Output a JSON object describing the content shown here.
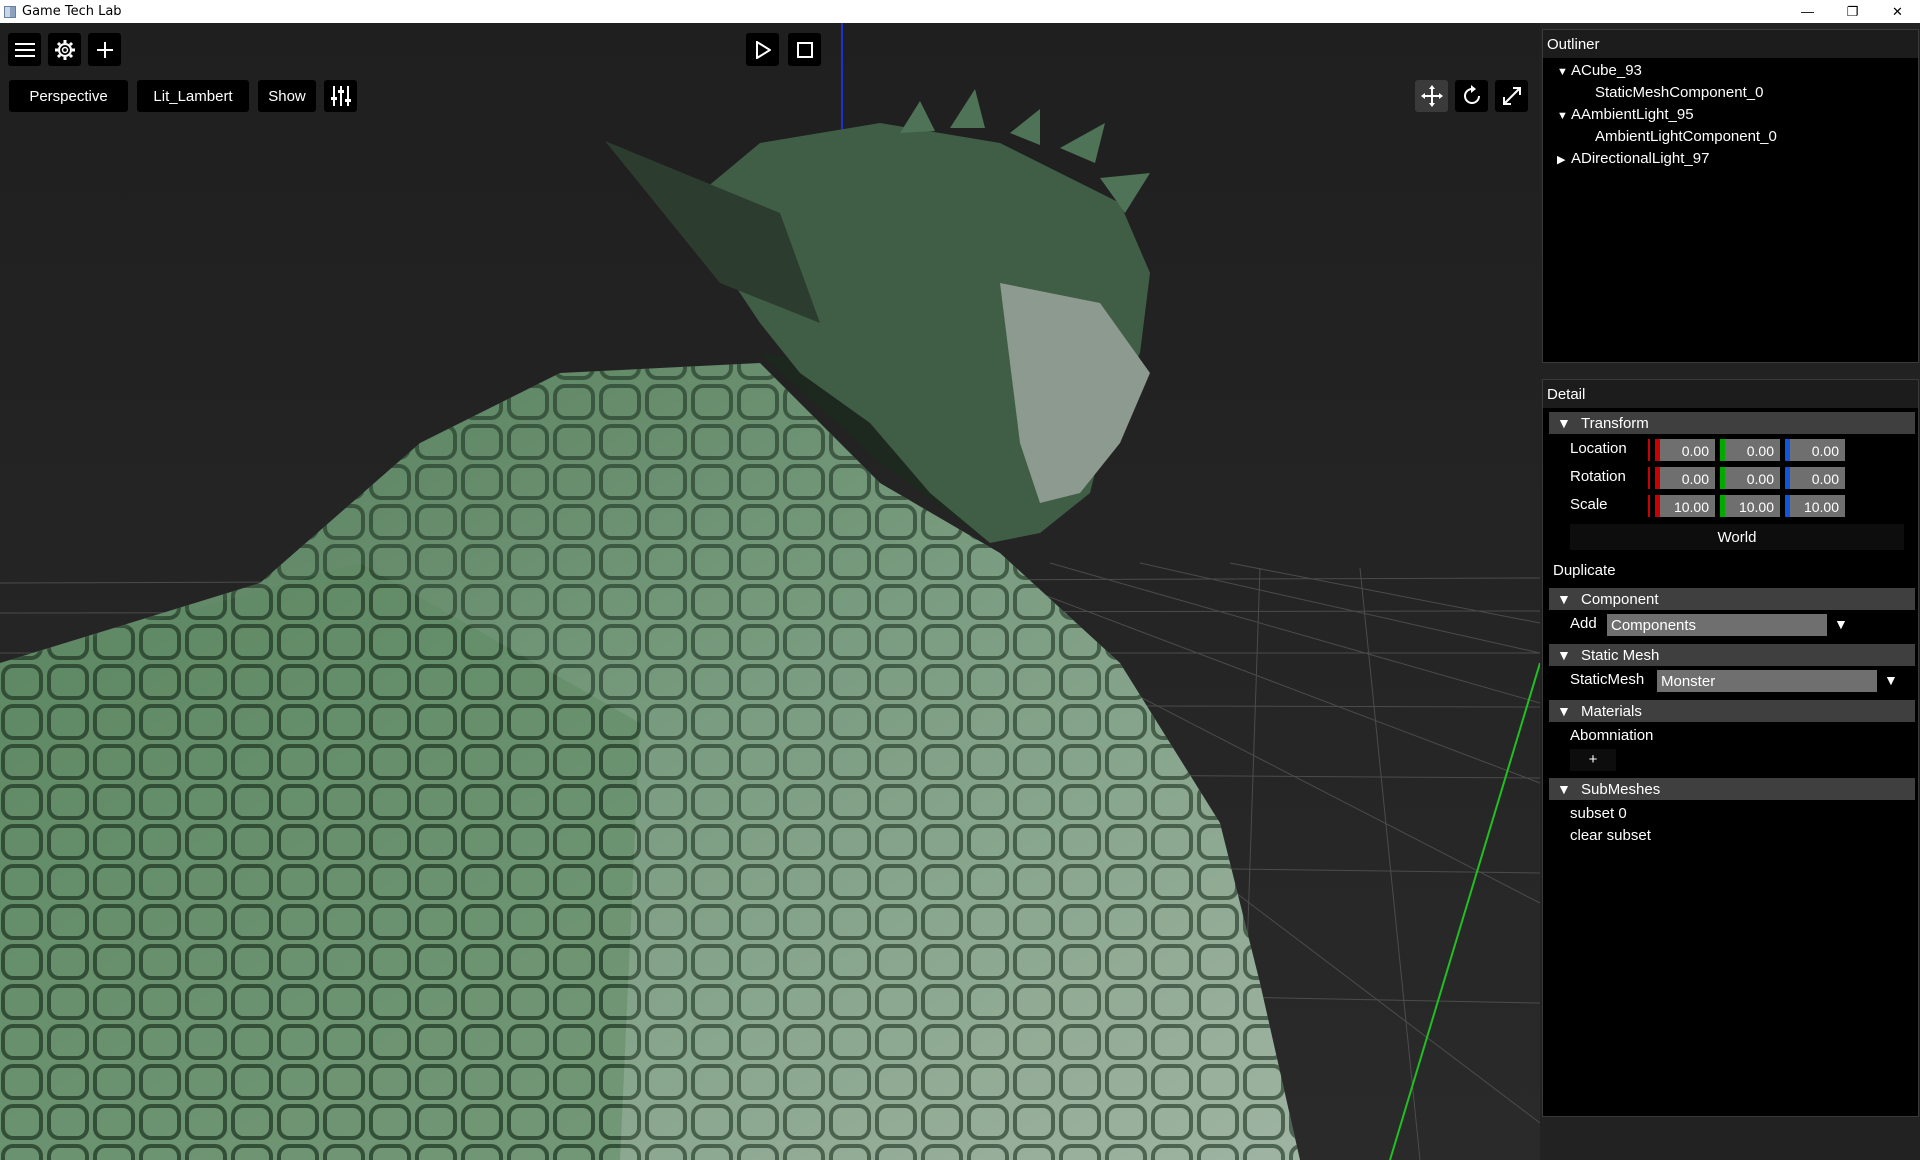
{
  "window": {
    "title": "Game Tech Lab",
    "minimize_glyph": "—",
    "restore_glyph": "❐",
    "close_glyph": "✕"
  },
  "viewport": {
    "view_mode": "Perspective",
    "view_shading": "Lit_Lambert",
    "show_label": "Show",
    "icons": [
      "menu-icon",
      "gear-icon",
      "plus-icon",
      "play-icon",
      "stop-icon",
      "sliders-icon",
      "move-icon",
      "rotate-icon",
      "scale-icon"
    ],
    "colors": {
      "background": "#232323",
      "grid": "#5a5a5a",
      "axis_y": "#20c020",
      "axis_z": "#2030d0",
      "mesh": "#5f8a6a"
    }
  },
  "outliner": {
    "title": "Outliner",
    "items": [
      {
        "label": "ACube_93",
        "expanded": true
      },
      {
        "label": "StaticMeshComponent_0"
      },
      {
        "label": "AAmbientLight_95",
        "expanded": true
      },
      {
        "label": "AmbientLightComponent_0"
      },
      {
        "label": "ADirectionalLight_97",
        "expanded": false
      }
    ]
  },
  "detail": {
    "title": "Detail",
    "transform": {
      "header": "Transform",
      "location_label": "Location",
      "rotation_label": "Rotation",
      "scale_label": "Scale",
      "location": [
        "0.00",
        "0.00",
        "0.00"
      ],
      "rotation": [
        "0.00",
        "0.00",
        "0.00"
      ],
      "scale": [
        "10.00",
        "10.00",
        "10.00"
      ],
      "space_button": "World"
    },
    "duplicate_label": "Duplicate",
    "component": {
      "header": "Component",
      "add_label": "Add",
      "add_value": "Components"
    },
    "static_mesh": {
      "header": "Static Mesh",
      "label": "StaticMesh",
      "value": "Monster"
    },
    "materials": {
      "header": "Materials",
      "item": "Abomniation",
      "add_button": "+"
    },
    "submeshes": {
      "header": "SubMeshes",
      "items": [
        "subset 0",
        "clear subset"
      ]
    },
    "axis_colors": {
      "x": "#cc0000",
      "y": "#00aa00",
      "z": "#1155dd"
    }
  }
}
